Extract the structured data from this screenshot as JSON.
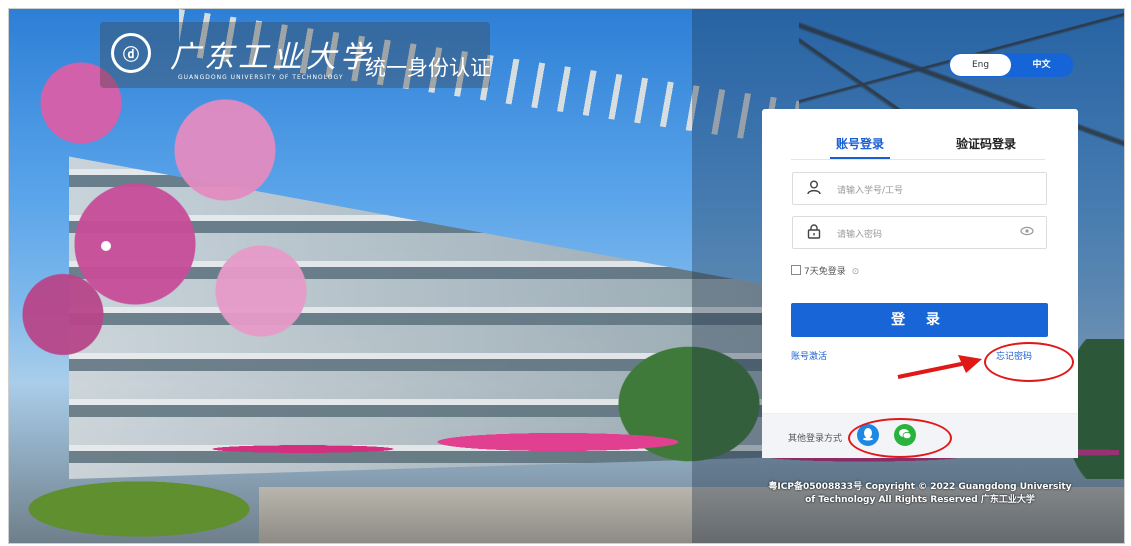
{
  "header": {
    "university_name": "广东工业大学",
    "university_name_en": "GUANGDONG UNIVERSITY OF TECHNOLOGY",
    "portal_title": "统一身份认证"
  },
  "language": {
    "english": "Eng",
    "chinese": "中文",
    "selected": "中文"
  },
  "login": {
    "tabs": [
      "账号登录",
      "验证码登录"
    ],
    "active_tab": "账号登录",
    "username_placeholder": "请输入学号/工号",
    "password_placeholder": "请输入密码",
    "remember_label": "7天免登录",
    "submit_label": "登 录",
    "activate_link": "账号激活",
    "forgot_link": "忘记密码",
    "other_methods_label": "其他登录方式"
  },
  "icons": {
    "user": "user-icon",
    "lock": "lock-icon",
    "eye": "eye-icon",
    "help": "help-icon",
    "qq": "qq-icon",
    "wechat": "wechat-icon"
  },
  "footer": {
    "line1": "粤ICP备05008833号 Copyright © 2022 Guangdong University",
    "line2": "of Technology All Rights Reserved 广东工业大学"
  },
  "colors": {
    "primary": "#1765d7",
    "annotation": "#e01818",
    "wechat": "#27b33c",
    "qq": "#1e88e5"
  }
}
